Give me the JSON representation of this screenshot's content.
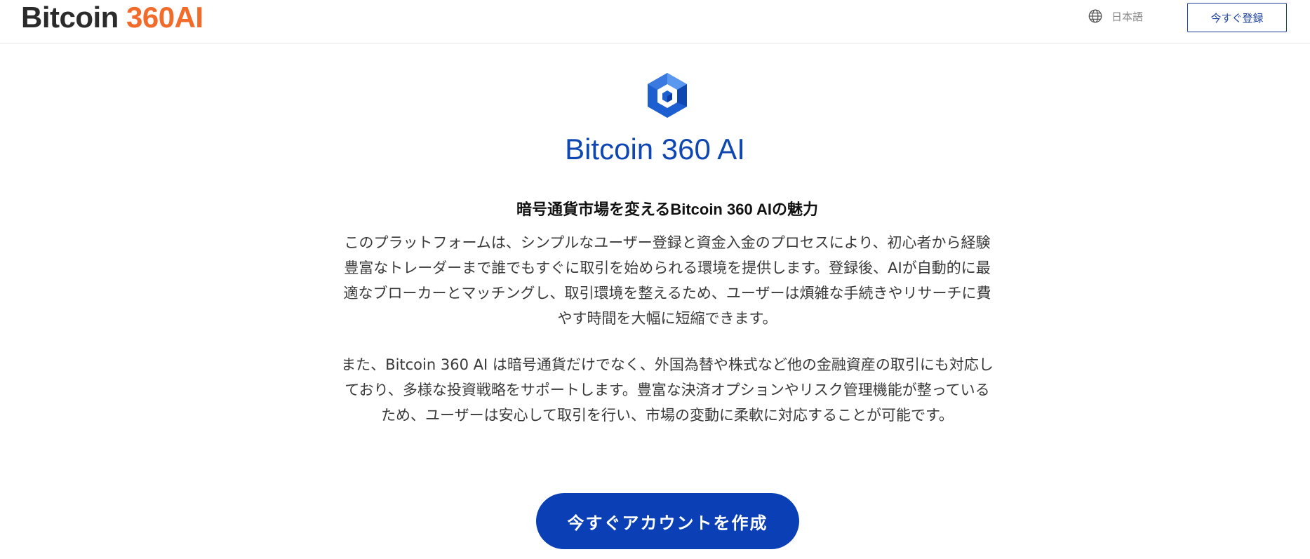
{
  "header": {
    "logo_part1": "Bitcoin",
    "logo_part2": "360AI",
    "language": "日本語",
    "register_label": "今すぐ登録"
  },
  "brand": {
    "title": "Bitcoin 360 AI"
  },
  "section": {
    "heading": "暗号通貨市場を変えるBitcoin 360 AIの魅力",
    "paragraphs": [
      "このプラットフォームは、シンプルなユーザー登録と資金入金のプロセスにより、初心者から経験豊富なトレーダーまで誰でもすぐに取引を始められる環境を提供します。登録後、AIが自動的に最適なブローカーとマッチングし、取引環境を整えるため、ユーザーは煩雑な手続きやリサーチに費やす時間を大幅に短縮できます。",
      "また、Bitcoin 360 AI は暗号通貨だけでなく、外国為替や株式など他の金融資産の取引にも対応しており、多様な投資戦略をサポートします。豊富な決済オプションやリスク管理機能が整っているため、ユーザーは安心して取引を行い、市場の変動に柔軟に対応することが可能です。"
    ]
  },
  "cta": {
    "label": "今すぐアカウントを作成"
  },
  "colors": {
    "brand_blue": "#0f47b2",
    "accent_orange": "#f26b2a",
    "cta_blue": "#0a3fb5"
  },
  "icons": {
    "language": "globe-icon",
    "brand": "hexagon-cube-logo-icon"
  }
}
